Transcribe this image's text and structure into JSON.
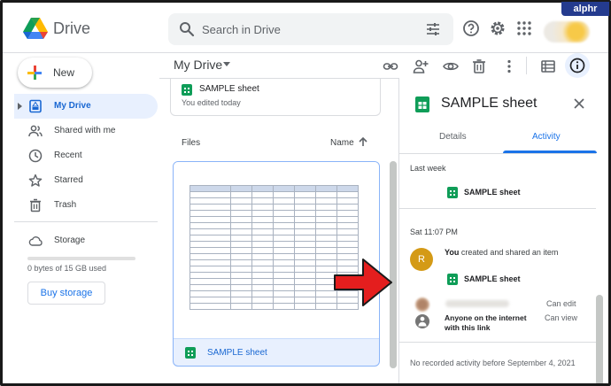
{
  "header": {
    "brand": "Drive",
    "search_placeholder": "Search in Drive",
    "watermark": "alphr"
  },
  "sidebar": {
    "new_label": "New",
    "items": [
      {
        "label": "My Drive",
        "icon": "my-drive-icon",
        "active": true
      },
      {
        "label": "Shared with me",
        "icon": "people-icon",
        "active": false
      },
      {
        "label": "Recent",
        "icon": "clock-icon",
        "active": false
      },
      {
        "label": "Starred",
        "icon": "star-icon",
        "active": false
      },
      {
        "label": "Trash",
        "icon": "trash-icon",
        "active": false
      }
    ],
    "storage_label": "Storage",
    "storage_used_text": "0 bytes of 15 GB used",
    "storage_used_fraction": 0.0,
    "buy_storage_label": "Buy storage"
  },
  "main": {
    "title": "My Drive",
    "quick_access": {
      "title": "SAMPLE sheet",
      "subtitle": "You edited today"
    },
    "files_label": "Files",
    "sort_label": "Name",
    "file": {
      "title": "SAMPLE sheet"
    }
  },
  "details": {
    "title": "SAMPLE sheet",
    "tabs": [
      "Details",
      "Activity"
    ],
    "active_tab": "Activity",
    "last_week_label": "Last week",
    "last_week_item": "SAMPLE sheet",
    "date_label": "Sat 11:07 PM",
    "actor_initial": "R",
    "actor_name": "You",
    "action_text": "created and shared an item",
    "shared_item": "SAMPLE sheet",
    "perm_user_role": "Can edit",
    "perm_public_label_1": "Anyone on the internet",
    "perm_public_label_2": "with this link",
    "perm_public_role": "Can view",
    "footer_note": "No recorded activity before September 4, 2021"
  },
  "colors": {
    "accent_blue": "#1a73e8",
    "active_nav_bg": "#e8f0fe",
    "sheets_green": "#0f9d58",
    "arrow_red": "#e41e1e",
    "avatar_gold": "#d49a16"
  }
}
